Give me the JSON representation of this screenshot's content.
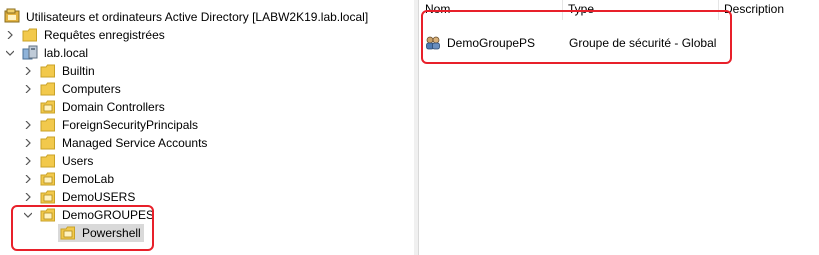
{
  "tree": {
    "root_label": "Utilisateurs et ordinateurs Active Directory [LABW2K19.lab.local]",
    "items": [
      {
        "label": "Requêtes enregistrées"
      },
      {
        "label": "lab.local"
      },
      {
        "label": "Builtin"
      },
      {
        "label": "Computers"
      },
      {
        "label": "Domain Controllers"
      },
      {
        "label": "ForeignSecurityPrincipals"
      },
      {
        "label": "Managed Service Accounts"
      },
      {
        "label": "Users"
      },
      {
        "label": "DemoLab"
      },
      {
        "label": "DemoUSERS"
      },
      {
        "label": "DemoGROUPES"
      },
      {
        "label": "Powershell"
      }
    ]
  },
  "list": {
    "columns": {
      "name": "Nom",
      "type": "Type",
      "description": "Description"
    },
    "rows": [
      {
        "name": "DemoGroupePS",
        "type": "Groupe de sécurité - Global",
        "description": ""
      }
    ]
  },
  "colors": {
    "highlight": "#e8202a",
    "selection": "#d9d9d9",
    "folder": "#f2c94c"
  }
}
